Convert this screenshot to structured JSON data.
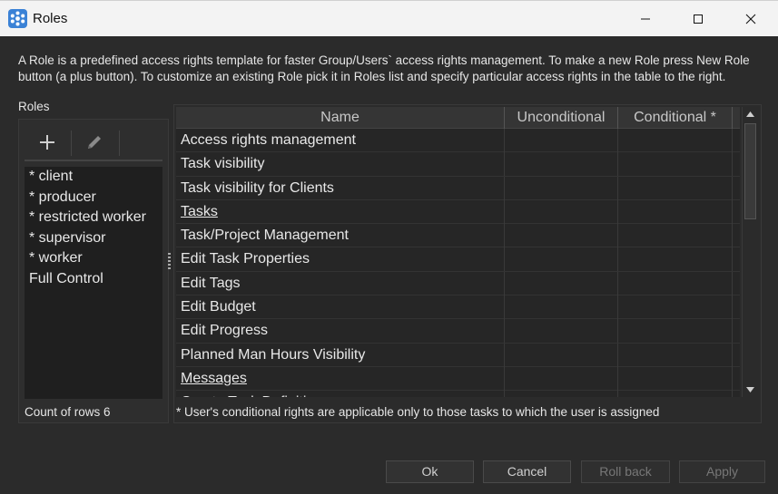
{
  "window": {
    "title": "Roles",
    "controls": {
      "minimize": "minimize-icon",
      "maximize": "maximize-icon",
      "close": "close-icon"
    }
  },
  "description": "A Role is a predefined access rights template for faster Group/Users` access rights management. To make a new Role press New Role button (a plus button). To customize an existing Role pick it in Roles list and specify particular access rights in the table to the right.",
  "roles_panel": {
    "label": "Roles",
    "toolbar": {
      "add": "plus-icon",
      "edit": "pencil-icon"
    },
    "items": [
      {
        "label": "* client"
      },
      {
        "label": "* producer"
      },
      {
        "label": "* restricted worker"
      },
      {
        "label": "* supervisor"
      },
      {
        "label": "* worker"
      },
      {
        "label": "Full Control"
      }
    ],
    "count_text": "Count of rows 6"
  },
  "rights_table": {
    "columns": [
      "Name",
      "Unconditional",
      "Conditional *"
    ],
    "rows": [
      {
        "name": "Access rights management",
        "link": false
      },
      {
        "name": "Task visibility",
        "link": false
      },
      {
        "name": "Task visibility for Clients",
        "link": false
      },
      {
        "name": "Tasks",
        "link": true
      },
      {
        "name": "Task/Project Management",
        "link": false
      },
      {
        "name": "Edit Task Properties",
        "link": false
      },
      {
        "name": "Edit Tags",
        "link": false
      },
      {
        "name": "Edit Budget",
        "link": false
      },
      {
        "name": "Edit Progress",
        "link": false
      },
      {
        "name": "Planned Man Hours Visibility",
        "link": false
      },
      {
        "name": "Messages",
        "link": true
      },
      {
        "name": "Create Task Definition",
        "link": false
      }
    ],
    "footnote": "* User's conditional rights are applicable only to those tasks to which the user is assigned"
  },
  "buttons": {
    "ok": "Ok",
    "cancel": "Cancel",
    "rollback": "Roll back",
    "apply": "Apply"
  },
  "colors": {
    "background": "#2b2b2b",
    "titlebar": "#f3f3f3",
    "list_background": "#1f1f1f",
    "app_icon": "#3b82d6"
  }
}
